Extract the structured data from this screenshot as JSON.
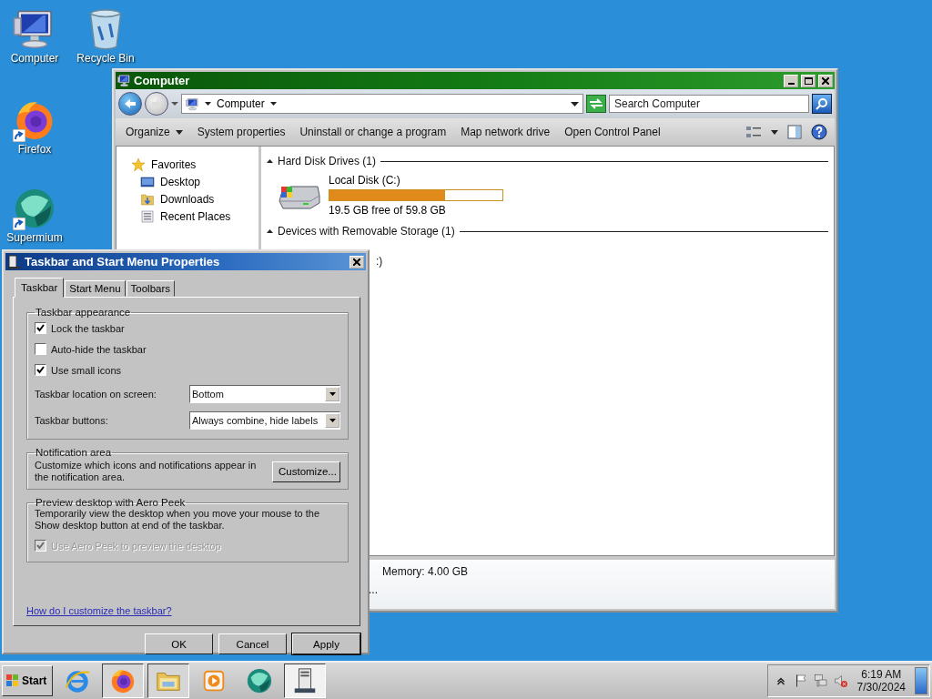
{
  "desktop": {
    "icons": [
      {
        "kind": "computer",
        "label": "Computer"
      },
      {
        "kind": "recycle",
        "label": "Recycle Bin"
      },
      {
        "kind": "firefox",
        "label": "Firefox"
      },
      {
        "kind": "supermium",
        "label": "Supermium"
      }
    ]
  },
  "explorer": {
    "title": "Computer",
    "address": {
      "crumb": "Computer"
    },
    "search": {
      "placeholder": "Search Computer"
    },
    "toolbar": [
      {
        "kind": "menu",
        "label": "Organize"
      },
      {
        "kind": "command",
        "label": "System properties"
      },
      {
        "kind": "command",
        "label": "Uninstall or change a program"
      },
      {
        "kind": "command",
        "label": "Map network drive"
      },
      {
        "kind": "command",
        "label": "Open Control Panel"
      }
    ],
    "nav": [
      {
        "kind": "star",
        "label": "Favorites",
        "children": [
          {
            "kind": "desktop",
            "label": "Desktop"
          },
          {
            "kind": "downloads",
            "label": "Downloads"
          },
          {
            "kind": "recent",
            "label": "Recent Places"
          }
        ]
      }
    ],
    "groups": [
      {
        "title": "Hard Disk Drives (1)",
        "items": [
          {
            "kind": "drive",
            "name": "Local Disk (C:)",
            "level": 0.67,
            "detail": "19.5 GB free of 59.8 GB"
          }
        ]
      },
      {
        "title": "Devices with Removable Storage (1)",
        "items": [
          {
            "kind": "partial",
            "name": ":)"
          }
        ]
      }
    ],
    "details": [
      "Memory: 4.00 GB",
      "..."
    ]
  },
  "dialog": {
    "title": "Taskbar and Start Menu Properties",
    "tabs": [
      {
        "label": "Taskbar",
        "selected": true
      },
      {
        "label": "Start Menu",
        "selected": false
      },
      {
        "label": "Toolbars",
        "selected": false
      }
    ],
    "groups": [
      {
        "title": "Taskbar appearance",
        "rows": [
          {
            "kind": "checkbox",
            "label": "Lock the taskbar",
            "checked": true,
            "disabled": false
          },
          {
            "kind": "checkbox",
            "label": "Auto-hide the taskbar",
            "checked": false,
            "disabled": false
          },
          {
            "kind": "checkbox",
            "label": "Use small icons",
            "checked": true,
            "disabled": false
          },
          {
            "kind": "select",
            "label": "Taskbar location on screen:",
            "value": "Bottom"
          },
          {
            "kind": "select",
            "label": "Taskbar buttons:",
            "value": "Always combine, hide labels"
          }
        ]
      },
      {
        "title": "Notification area",
        "rows": [
          {
            "kind": "text_button",
            "text": "Customize which icons and notifications appear in the notification area.",
            "button": "Customize..."
          }
        ]
      },
      {
        "title": "Preview desktop with Aero Peek",
        "rows": [
          {
            "kind": "text",
            "text": "Temporarily view the desktop when you move your mouse to the Show desktop button at end of the taskbar."
          },
          {
            "kind": "checkbox",
            "label": "Use Aero Peek to preview the desktop",
            "checked": true,
            "disabled": true
          }
        ]
      }
    ],
    "link": "How do I customize the taskbar?",
    "buttons": [
      {
        "label": "OK",
        "focused": false
      },
      {
        "label": "Cancel",
        "focused": false
      },
      {
        "label": "Apply",
        "focused": true
      }
    ]
  },
  "taskbar": {
    "start": "Start",
    "apps": [
      {
        "kind": "ie",
        "open": false,
        "selected": false
      },
      {
        "kind": "firefox",
        "open": true,
        "selected": false
      },
      {
        "kind": "folder",
        "open": true,
        "selected": false
      },
      {
        "kind": "media",
        "open": false,
        "selected": false
      },
      {
        "kind": "supermium",
        "open": false,
        "selected": false
      },
      {
        "kind": "server",
        "open": true,
        "selected": true
      }
    ],
    "tray": [
      {
        "kind": "chevron"
      },
      {
        "kind": "flag"
      },
      {
        "kind": "network"
      },
      {
        "kind": "volume-muted"
      }
    ],
    "time": "6:19 AM",
    "date": "7/30/2024"
  }
}
